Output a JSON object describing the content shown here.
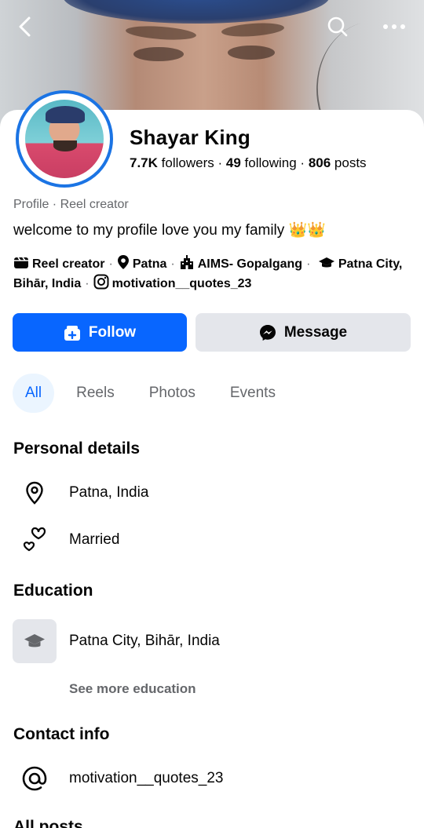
{
  "header": {
    "back_icon": "back-arrow-icon",
    "search_icon": "search-icon",
    "more_icon": "more-dots-icon"
  },
  "profile": {
    "name": "Shayar King",
    "followers_count": "7.7K",
    "followers_label": "followers",
    "following_count": "49",
    "following_label": "following",
    "posts_count": "806",
    "posts_label": "posts",
    "profile_type": "Profile · Reel creator",
    "bio": "welcome to my profile love you my family 👑👑",
    "ring_color": "#1b74e4"
  },
  "intro": {
    "category": "Reel creator",
    "location": "Patna",
    "work": "AIMS- Gopalgang",
    "education": "Patna City, Bihār, India",
    "instagram": "motivation__quotes_23"
  },
  "actions": {
    "follow_label": "Follow",
    "message_label": "Message",
    "follow_color": "#0866ff"
  },
  "tabs": [
    {
      "label": "All",
      "active": true
    },
    {
      "label": "Reels",
      "active": false
    },
    {
      "label": "Photos",
      "active": false
    },
    {
      "label": "Events",
      "active": false
    }
  ],
  "personal_details": {
    "title": "Personal details",
    "location": "Patna, India",
    "relationship": "Married"
  },
  "education": {
    "title": "Education",
    "school": "Patna City, Bihār, India",
    "see_more": "See more education"
  },
  "contact": {
    "title": "Contact info",
    "instagram": "motivation__quotes_23"
  },
  "posts": {
    "title": "All posts"
  }
}
